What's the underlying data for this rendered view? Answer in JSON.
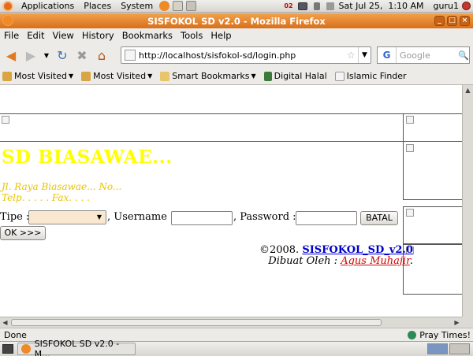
{
  "panel": {
    "menus": [
      "Applications",
      "Places",
      "System"
    ],
    "badge": "02",
    "clock": "Sat Jul 25,  1:10 AM",
    "user": "guru1"
  },
  "window": {
    "title": "SISFOKOL SD v2.0 - Mozilla Firefox"
  },
  "menubar": [
    "File",
    "Edit",
    "View",
    "History",
    "Bookmarks",
    "Tools",
    "Help"
  ],
  "nav": {
    "url": "http://localhost/sisfokol-sd/login.php",
    "search_placeholder": "Google"
  },
  "bookmarks": [
    "Most Visited",
    "Most Visited",
    "Smart Bookmarks",
    "Digital Halal",
    "Islamic Finder"
  ],
  "page": {
    "school_name": "SD BIASAWAE...",
    "address": "Jl. Raya Biasawae... No...",
    "phone": "Telp. . . . . Fax. . . .",
    "tipe_label": "Tipe :",
    "username_label": ", Username :",
    "password_label": ", Password :",
    "batal": "BATAL",
    "ok": "OK >>>",
    "copyright": "©2008.",
    "app_link": "SISFOKOL_SD_v2.0",
    "made_by": "Dibuat Oleh :",
    "author": "Agus Muhajir",
    "period": "."
  },
  "status": {
    "text": "Done",
    "pray": "Pray Times!"
  },
  "taskbar": {
    "task": "SISFOKOL SD v2.0 - M..."
  },
  "colors": {
    "school_name": "#ffff00",
    "address": "#e9c400",
    "link": "#0000cc",
    "author": "#d40000",
    "titlebar": "#e07a22"
  }
}
